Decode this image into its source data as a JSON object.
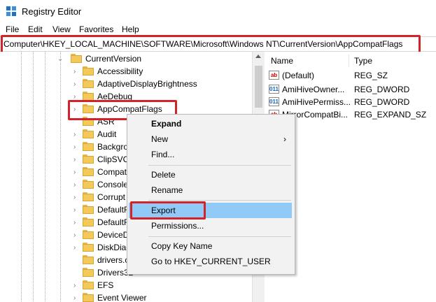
{
  "window": {
    "title": "Registry Editor"
  },
  "menu": [
    "File",
    "Edit",
    "View",
    "Favorites",
    "Help"
  ],
  "address": "Computer\\HKEY_LOCAL_MACHINE\\SOFTWARE\\Microsoft\\Windows NT\\CurrentVersion\\AppCompatFlags",
  "tree": {
    "parent": "CurrentVersion",
    "items": [
      "Accessibility",
      "AdaptiveDisplayBrightness",
      "AeDebug",
      "AppCompatFlags",
      "ASR",
      "Audit",
      "Backgro",
      "ClipSVC",
      "Compat",
      "Console",
      "Corrupt",
      "DefaultR",
      "DefaultR",
      "DeviceD",
      "DiskDiag",
      "drivers.c",
      "Drivers32",
      "EFS",
      "Event Viewer"
    ],
    "selected": "AppCompatFlags"
  },
  "list": {
    "headers": {
      "name": "Name",
      "type": "Type"
    },
    "rows": [
      {
        "icon": "ab",
        "name": "(Default)",
        "type": "REG_SZ"
      },
      {
        "icon": "dword",
        "name": "AmiHiveOwner...",
        "type": "REG_DWORD"
      },
      {
        "icon": "dword",
        "name": "AmiHivePermiss...",
        "type": "REG_DWORD"
      },
      {
        "icon": "ab",
        "name": "MirrorCompatBi...",
        "type": "REG_EXPAND_SZ"
      }
    ]
  },
  "context_menu": {
    "expand": "Expand",
    "new": "New",
    "find": "Find...",
    "delete": "Delete",
    "rename": "Rename",
    "export": "Export",
    "permissions": "Permissions...",
    "copy_key_name": "Copy Key Name",
    "goto": "Go to HKEY_CURRENT_USER",
    "submenu_arrow": "›"
  },
  "colors": {
    "highlight_box": "#d2232a",
    "menu_hover": "#91c9f7",
    "folder": "#f3c95b"
  }
}
